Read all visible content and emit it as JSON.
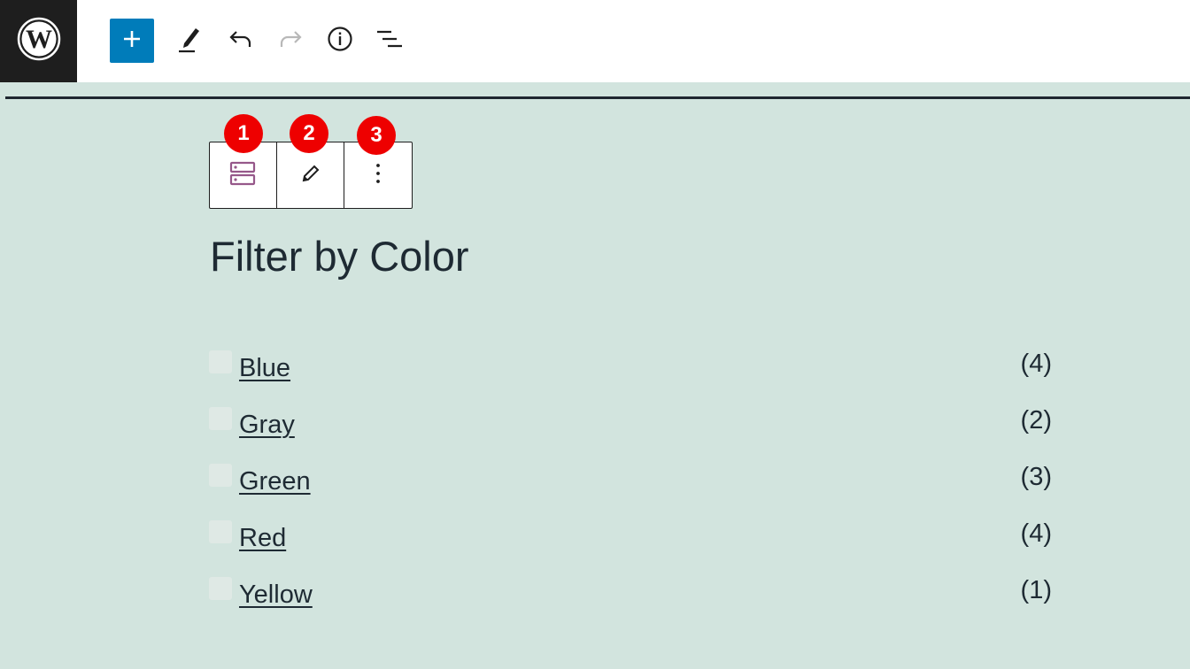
{
  "toolbar": {
    "logo_icon": "wordpress-logo-icon",
    "add_icon": "plus-icon",
    "edit_icon": "pencil-icon",
    "undo_icon": "undo-icon",
    "redo_icon": "redo-icon",
    "info_icon": "info-icon",
    "list_view_icon": "list-view-icon",
    "accent_color": "#007cba"
  },
  "block_toolbar": {
    "buttons": [
      {
        "icon": "block-type-icon",
        "badge": "1"
      },
      {
        "icon": "pencil-icon",
        "badge": "2"
      },
      {
        "icon": "more-options-icon",
        "badge": "3"
      }
    ],
    "badge_color": "#ee0000"
  },
  "heading": "Filter by Color",
  "filters": [
    {
      "label": "Blue",
      "count": "(4)"
    },
    {
      "label": "Gray",
      "count": "(2)"
    },
    {
      "label": "Green",
      "count": "(3)"
    },
    {
      "label": "Red",
      "count": "(4)"
    },
    {
      "label": "Yellow",
      "count": "(1)"
    }
  ]
}
